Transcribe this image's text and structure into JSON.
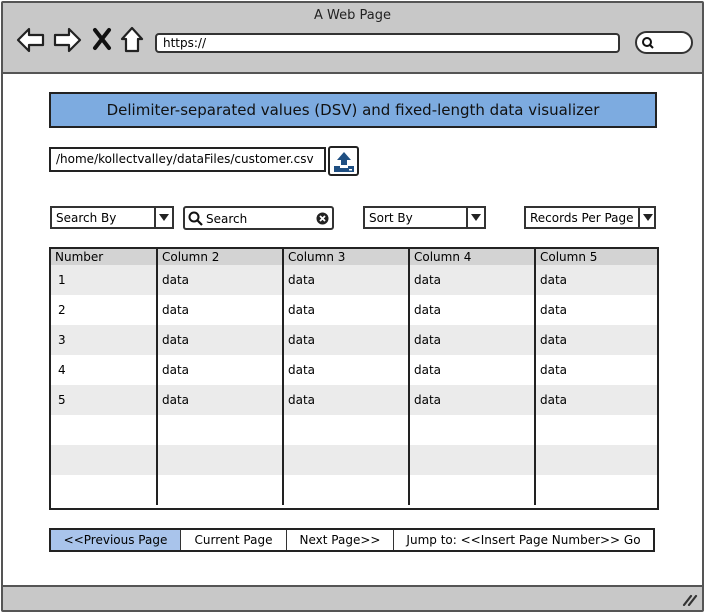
{
  "browser": {
    "title": "A Web Page",
    "url": "https://"
  },
  "app": {
    "header": "Delimiter-separated values (DSV) and fixed-length data visualizer",
    "file_path": "/home/kollectvalley/dataFiles/customer.csv"
  },
  "controls": {
    "search_by": "Search By",
    "search_placeholder": "Search",
    "sort_by": "Sort By",
    "records_per_page": "Records Per Page"
  },
  "table": {
    "columns": [
      "Number",
      "Column 2",
      "Column 3",
      "Column 4",
      "Column 5"
    ],
    "rows": [
      [
        "1",
        "data",
        "data",
        "data",
        "data"
      ],
      [
        "2",
        "data",
        "data",
        "data",
        "data"
      ],
      [
        "3",
        "data",
        "data",
        "data",
        "data"
      ],
      [
        "4",
        "data",
        "data",
        "data",
        "data"
      ],
      [
        "5",
        "data",
        "data",
        "data",
        "data"
      ],
      [
        "",
        "",
        "",
        "",
        ""
      ],
      [
        "",
        "",
        "",
        "",
        ""
      ],
      [
        "",
        "",
        "",
        "",
        ""
      ]
    ]
  },
  "pagination": {
    "previous": "<<Previous Page",
    "current": "Current Page",
    "next": "Next Page>>",
    "jump": "Jump to: <<Insert Page Number>> Go"
  },
  "colors": {
    "header_bg": "#7dabe0",
    "active_page_bg": "#a9c4eb",
    "chrome_bg": "#c8c8c8"
  }
}
